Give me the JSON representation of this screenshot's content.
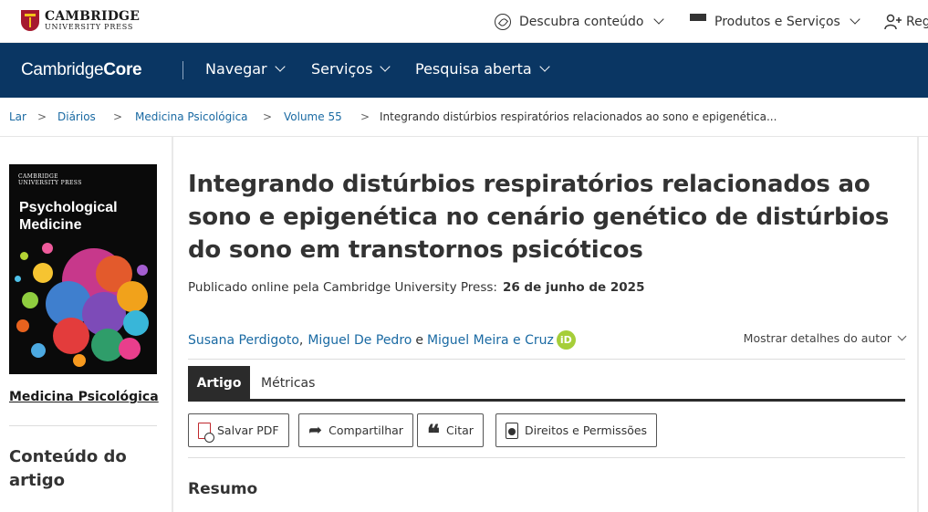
{
  "header": {
    "publisher_name": "CAMBRIDGE",
    "publisher_sub": "UNIVERSITY PRESS",
    "nav": [
      {
        "label": "Descubra conteúdo",
        "icon": "compass-icon"
      },
      {
        "label": "Produtos e Serviços",
        "icon": "grid-icon"
      },
      {
        "label": "Reg",
        "icon": "person-plus-icon"
      }
    ]
  },
  "mainnav": {
    "logo_regular": "Cambridge",
    "logo_bold": "Core",
    "items": [
      "Navegar",
      "Serviços",
      "Pesquisa aberta"
    ],
    "background": "#0a3663"
  },
  "breadcrumb": {
    "items": [
      "Lar",
      "Diários",
      "Medicina Psicológica",
      "Volume 55",
      "Integrando distúrbios respiratórios relacionados ao sono e epigenética..."
    ],
    "separator": ">"
  },
  "sidebar": {
    "cover": {
      "press_line1": "CAMBRIDGE",
      "press_line2": "UNIVERSITY PRESS",
      "title_line1": "Psychological",
      "title_line2": "Medicine"
    },
    "journal_link": "Medicina Psicológica",
    "section_heading": "Conteúdo do artigo"
  },
  "article": {
    "title": "Integrando distúrbios respiratórios relacionados ao sono e epigenética no cenário genético de distúrbios do sono em transtornos psicóticos",
    "published_label": "Publicado online pela Cambridge University Press:",
    "published_date": "26 de junho de 2025",
    "authors": [
      "Susana Perdigoto",
      "Miguel De Pedro",
      "Miguel Meira e Cruz"
    ],
    "author_joiner_comma": ",",
    "author_joiner_and": "e",
    "orcid_label": "iD",
    "author_details_label": "Mostrar detalhes do autor",
    "tabs": [
      "Artigo",
      "Métricas"
    ],
    "actions": [
      "Salvar PDF",
      "Compartilhar",
      "Citar",
      "Direitos e Permissões"
    ],
    "abstract_heading": "Resumo"
  },
  "colors": {
    "link": "#1a6aa3",
    "orcid": "#a6ce39",
    "tab_active": "#2b2b2b",
    "brand_red": "#a6192e"
  }
}
